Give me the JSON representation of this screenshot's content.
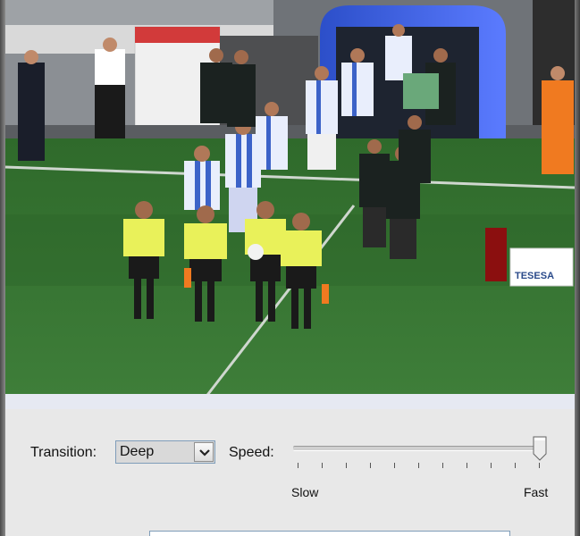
{
  "controls": {
    "transition_label": "Transition:",
    "transition_value": "Deep",
    "speed_label": "Speed:",
    "speed_min_label": "Slow",
    "speed_max_label": "Fast",
    "speed_value": 1.0
  },
  "photo": {
    "sponsor_text": "TESESA"
  },
  "icons": {
    "dropdown": "chevron-down-icon",
    "slider": "slider-thumb-icon"
  }
}
